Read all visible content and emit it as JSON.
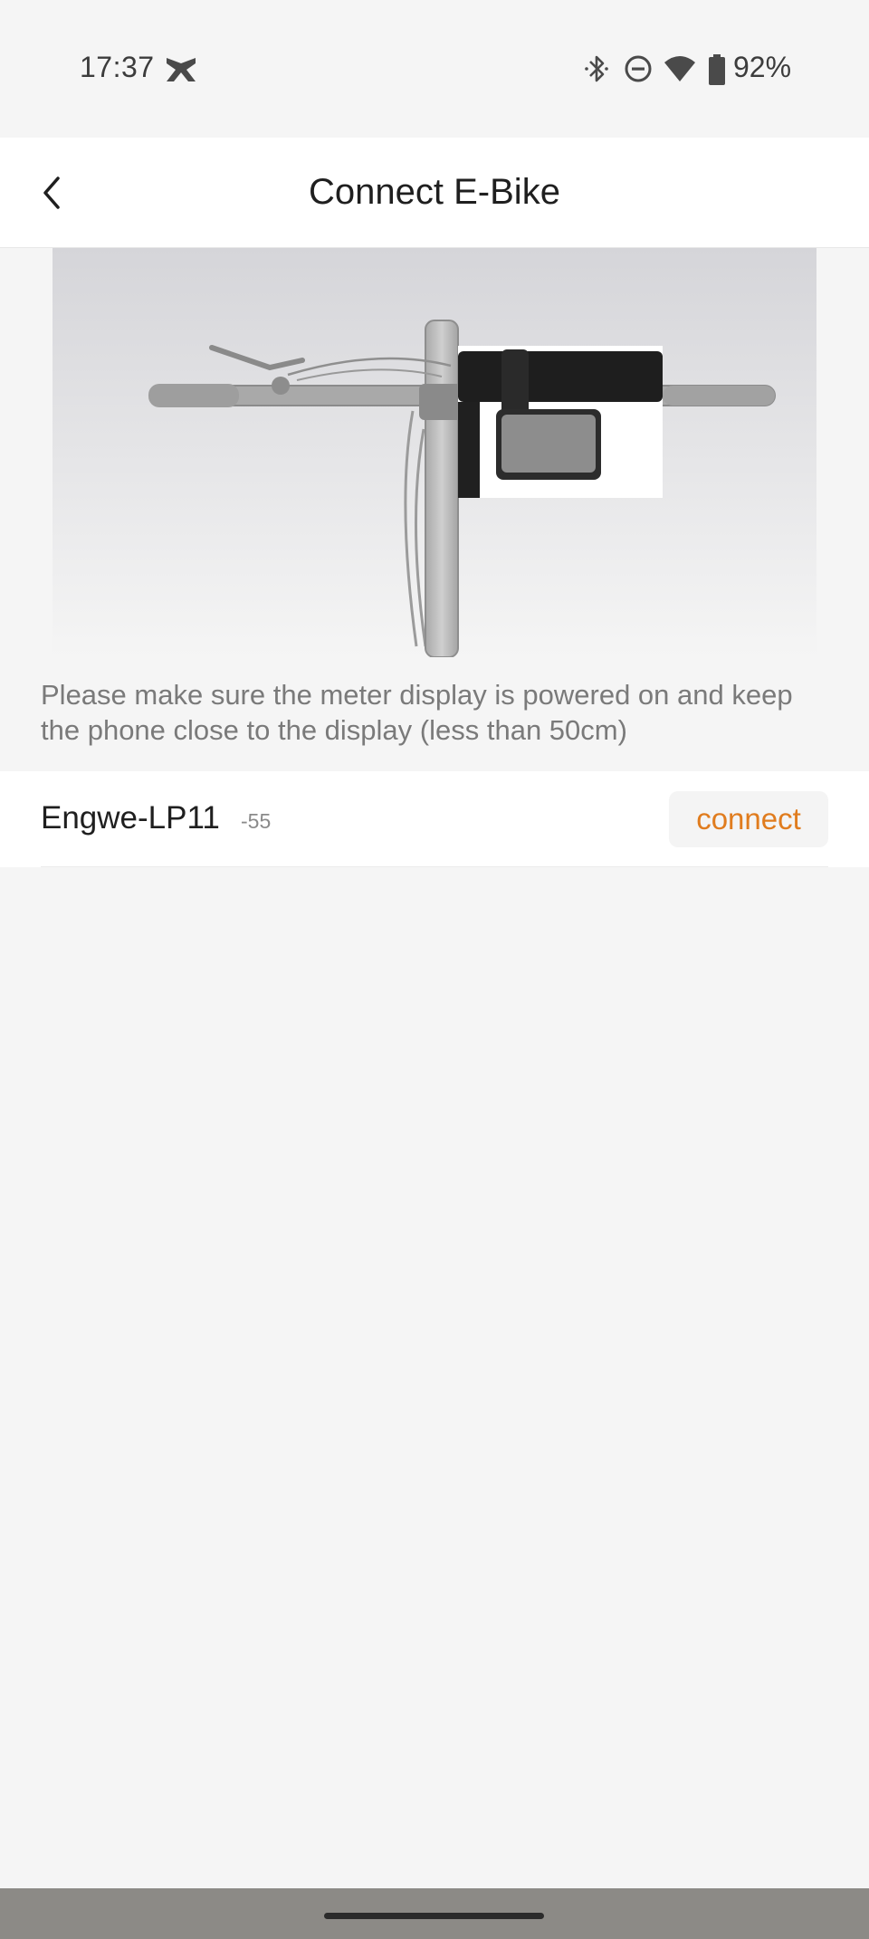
{
  "status_bar": {
    "time": "17:37",
    "battery_percent": "92%",
    "icons": [
      "notification-icon",
      "bluetooth-icon",
      "do-not-disturb-icon",
      "wifi-icon",
      "battery-icon"
    ]
  },
  "header": {
    "title": "Connect E-Bike",
    "back_icon": "chevron-left-icon"
  },
  "hero": {
    "illustration": "e-bike handlebar with meter display"
  },
  "instruction": "Please make sure the meter display is powered on and keep the phone close to the display (less than 50cm)",
  "devices": [
    {
      "name": "Engwe-LP11",
      "rssi": "-55",
      "action_label": "connect"
    }
  ],
  "colors": {
    "accent": "#e07c1e",
    "background": "#f5f5f5",
    "surface": "#ffffff",
    "secondary_text": "#7a7a7a"
  }
}
